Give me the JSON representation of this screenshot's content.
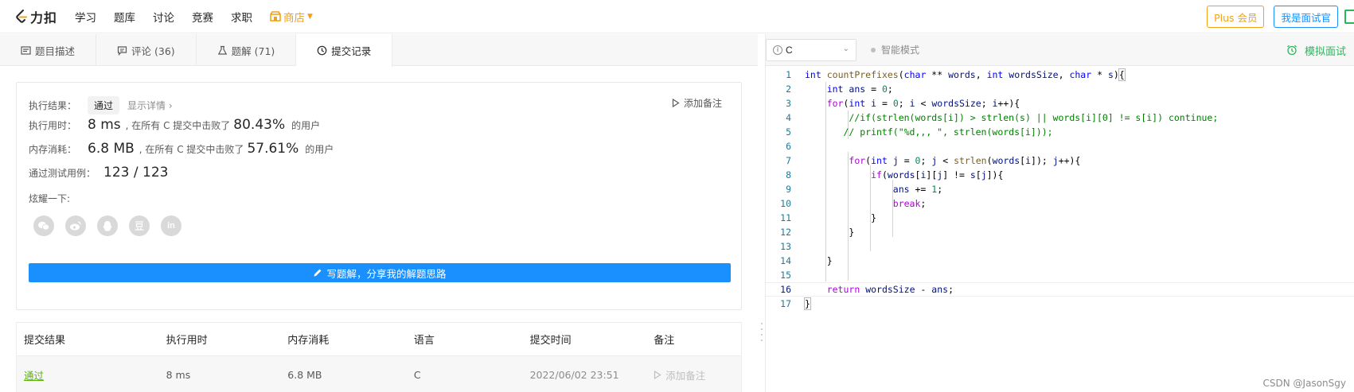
{
  "nav": {
    "logo_text": "力扣",
    "links": [
      "学习",
      "题库",
      "讨论",
      "竞赛",
      "求职"
    ],
    "store_label": "商店",
    "plus_label": "Plus 会员",
    "interviewer_label": "我是面试官"
  },
  "tabs": [
    {
      "label": "题目描述"
    },
    {
      "label": "评论 (36)"
    },
    {
      "label": "题解 (71)"
    },
    {
      "label": "提交记录"
    }
  ],
  "result": {
    "exec_result_label": "执行结果：",
    "exec_result_value": "通过",
    "show_details": "显示详情 ›",
    "add_note": "添加备注",
    "runtime_label": "执行用时：",
    "runtime_value": "8 ms",
    "runtime_beat_text": ", 在所有 C 提交中击败了",
    "runtime_pct": "80.43%",
    "users_suffix": "的用户",
    "memory_label": "内存消耗：",
    "memory_value": "6.8 MB",
    "memory_beat_text": ", 在所有 C 提交中击败了",
    "memory_pct": "57.61%",
    "tests_label": "通过测试用例：",
    "tests_value": "123 / 123",
    "share_label": "炫耀一下:",
    "write_solution": "写题解，分享我的解题思路"
  },
  "submissions": {
    "headers": [
      "提交结果",
      "执行用时",
      "内存消耗",
      "语言",
      "提交时间",
      "备注"
    ],
    "rows": [
      {
        "result": "通过",
        "runtime": "8 ms",
        "memory": "6.8 MB",
        "lang": "C",
        "time": "2022/06/02 23:51",
        "note": "添加备注"
      }
    ]
  },
  "editor": {
    "language": "C",
    "smart_mode": "智能模式",
    "mock_interview": "模拟面试",
    "current_line": 16,
    "code_lines": [
      "int countPrefixes(char ** words, int wordsSize, char * s){",
      "    int ans = 0;",
      "    for(int i = 0; i < wordsSize; i++){",
      "        //if(strlen(words[i]) > strlen(s) || words[i][0] != s[i]) continue;",
      "       // printf(\"%d,,, \", strlen(words[i]));",
      "",
      "        for(int j = 0; j < strlen(words[i]); j++){",
      "            if(words[i][j] != s[j]){",
      "                ans += 1;",
      "                break;",
      "            }",
      "        }",
      "",
      "    }",
      "",
      "    return wordsSize - ans;",
      "}"
    ]
  },
  "watermark": "CSDN @JasonSgy"
}
